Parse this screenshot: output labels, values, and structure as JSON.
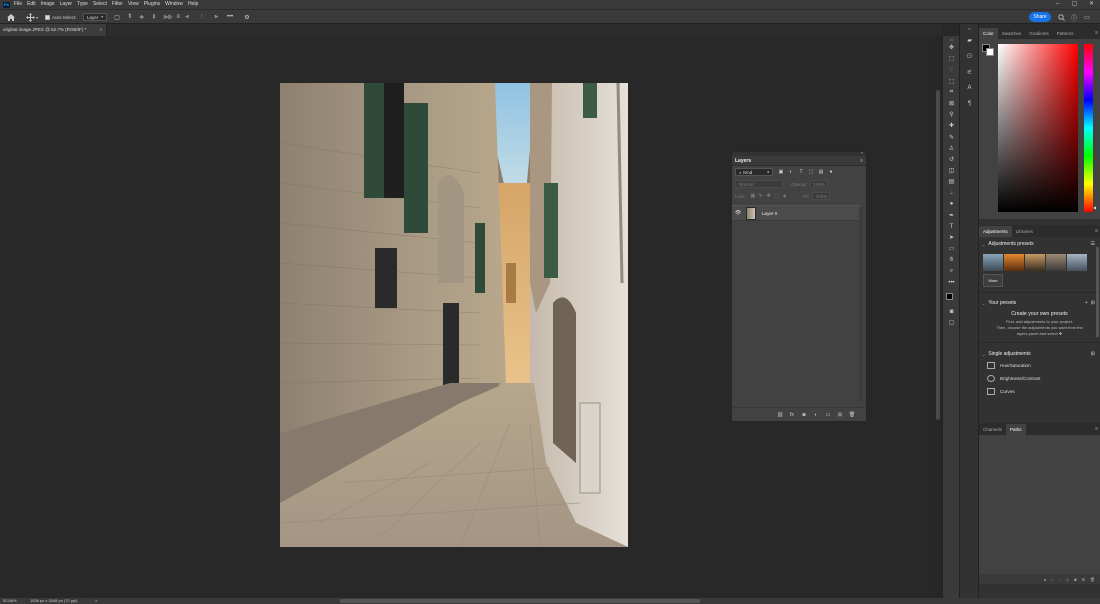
{
  "app": {
    "logo": "Ps"
  },
  "menu": [
    "File",
    "Edit",
    "Image",
    "Layer",
    "Type",
    "Select",
    "Filter",
    "View",
    "Plugins",
    "Window",
    "Help"
  ],
  "window_controls": {
    "minimize": "–",
    "maximize": "▢",
    "close": "✕"
  },
  "options_bar": {
    "auto_select_label": "Auto-Select:",
    "auto_select_value": "Layer",
    "share_label": "Share",
    "more_icon": "•••"
  },
  "document": {
    "tab_title": "original image.JPEG @ 52.7% (RGB/8*) *",
    "tab_close": "×"
  },
  "status": {
    "zoom": "52.66%",
    "doc_info": "1536 px x 2048 px (72 ppi)",
    "arrow": ">"
  },
  "color_panel": {
    "tabs": [
      "Color",
      "Swatches",
      "Gradients",
      "Patterns"
    ],
    "active_tab": "Color",
    "base_hue": "#ff0000",
    "fg": "#000000",
    "bg": "#ffffff"
  },
  "adjustments_panel": {
    "tabs": [
      "Adjustments",
      "Libraries"
    ],
    "presets_title": "Adjustments presets",
    "more_label": "More",
    "your_presets_title": "Your presets",
    "create_title": "Create your own presets",
    "create_desc1": "First, add adjustments to your project.",
    "create_desc2": "Then, choose the adjustments you want from the",
    "create_desc3": "layers panel and select",
    "single_title": "Single adjustments",
    "single_items": [
      "Hue/Saturation",
      "Brightness/Contrast",
      "Curves"
    ]
  },
  "paths_panel": {
    "tabs": [
      "Channels",
      "Paths"
    ],
    "active_tab": "Paths"
  },
  "layers_panel": {
    "title": "Layers",
    "filter_kind": "Kind",
    "blend_mode": "Normal",
    "opacity_label": "Opacity:",
    "opacity_value": "100%",
    "lock_label": "Lock:",
    "fill_label": "Fill:",
    "fill_value": "100%",
    "layers": [
      {
        "name": "Layer 0",
        "visible": true
      }
    ]
  }
}
